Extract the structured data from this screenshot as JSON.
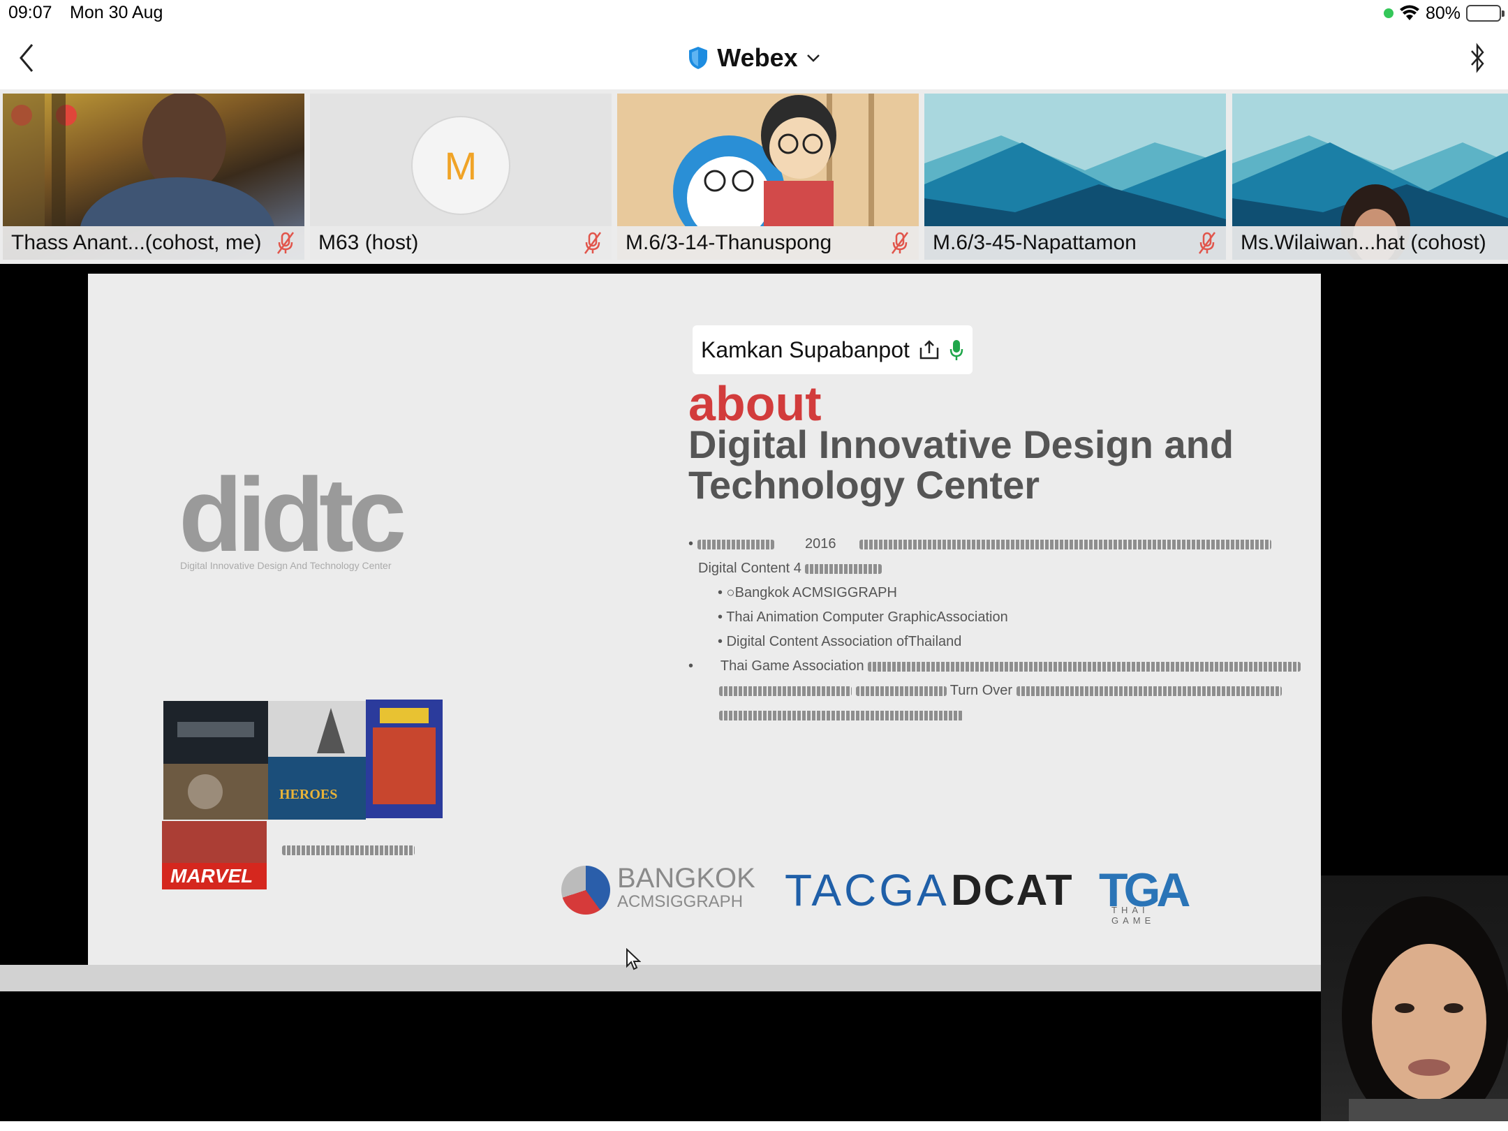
{
  "status_bar": {
    "time": "09:07",
    "date": "Mon 30 Aug",
    "battery": "80%",
    "battery_level": 0.8
  },
  "nav": {
    "title": "Webex"
  },
  "participants": [
    {
      "name": "Thass Anant...(cohost, me)",
      "muted": true
    },
    {
      "name": "M63 (host)",
      "avatar_letter": "M",
      "muted": true
    },
    {
      "name": "M.6/3-14-Thanuspong",
      "muted": true
    },
    {
      "name": "M.6/3-45-Napattamon",
      "muted": true
    },
    {
      "name": "Ms.Wilaiwan...hat (cohost)",
      "muted": false
    }
  ],
  "share": {
    "presenter": "Kamkan Supabanpot"
  },
  "slide": {
    "about": "about",
    "title_line1": "Digital Innovative Design and",
    "title_line2": "Technology Center",
    "year": "2016",
    "line2": "Digital Content 4",
    "associations": [
      "Bangkok ACMSIGGRAPH",
      "Thai Animation Computer GraphicAssociation",
      "Digital Content Association ofThailand"
    ],
    "tga_line": "Thai Game Association",
    "pagelabel": "Turn Over",
    "logo_text": "didtc",
    "logo_sub": "Digital Innovative Design And Technology Center",
    "collage_marvel": "MARVEL",
    "collage_heroes": "HEROES",
    "partner_bkk": "BANGKOK",
    "partner_bkk_sub": "ACMSIGGRAPH",
    "partner_tacga": "TACGA",
    "partner_dcat": "DCAT",
    "partner_tga": "TGA",
    "partner_tga_sub": "THAI GAME"
  },
  "colors": {
    "accent_red": "#d23c3c",
    "mic_green": "#1fa64a",
    "mute_red": "#e1554b",
    "webex_blue": "#1d8ce0"
  }
}
